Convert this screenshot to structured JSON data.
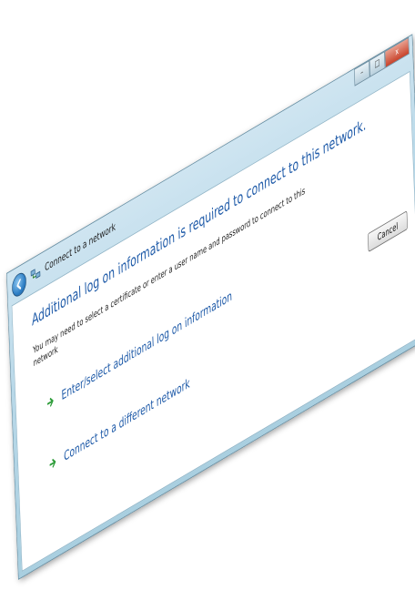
{
  "window": {
    "title": "Connect to a network",
    "caption_minimize": "–",
    "caption_maximize": "□",
    "caption_close": "x"
  },
  "content": {
    "heading": "Additional log on information is required to connect to this network.",
    "description": "You may need to select a certificate or enter a user name and password to connect to this network",
    "options": [
      {
        "label": "Enter/select additional log on information",
        "icon": "green-arrow-icon"
      },
      {
        "label": "Connect to a different network",
        "icon": "green-arrow-icon"
      }
    ],
    "cancel_label": "Cancel"
  },
  "colors": {
    "accent_text": "#1e5aa8",
    "option_arrow": "#2e9d3a",
    "frame_glass": "#b8d8e8"
  },
  "icons": {
    "back": "back-arrow-icon",
    "network": "network-icon"
  }
}
